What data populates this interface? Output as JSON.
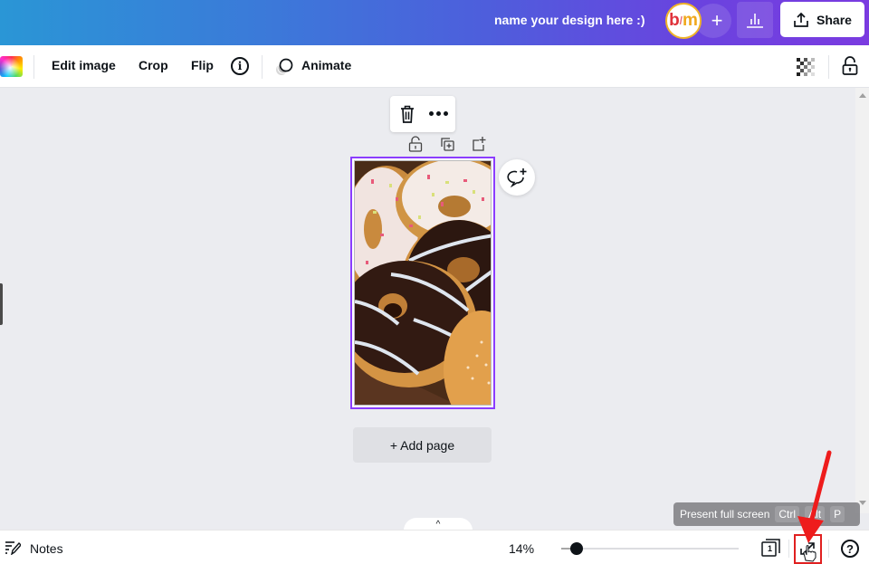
{
  "header": {
    "design_name": "name your design here :)",
    "avatar": {
      "letter1": "b",
      "separator": "/",
      "letter2": "m"
    },
    "add_collaborator_label": "+",
    "insights_icon": "bar-chart-icon",
    "share_label": "Share",
    "share_icon": "upload-icon"
  },
  "toolbar": {
    "color_icon": "color-palette-icon",
    "edit_image_label": "Edit image",
    "crop_label": "Crop",
    "flip_label": "Flip",
    "info_icon": "info-icon",
    "info_glyph": "i",
    "animate_label": "Animate",
    "transparency_icon": "transparency-icon",
    "lock_icon": "lock-icon"
  },
  "canvas": {
    "context_menu": {
      "delete_icon": "trash-icon",
      "more_icon": "more-icon"
    },
    "page_actions": [
      "lock-icon",
      "duplicate-icon",
      "add-page-icon"
    ],
    "comment_icon": "add-comment-icon",
    "page_image": "donuts-photo",
    "add_page_label": "+ Add page"
  },
  "tooltip": {
    "text": "Present full screen",
    "keys": [
      "Ctrl",
      "Alt",
      "P"
    ]
  },
  "bottombar": {
    "expand_glyph": "^",
    "notes_label": "Notes",
    "zoom_value": "14%",
    "zoom_percent": 14,
    "page_count": "1",
    "help_glyph": "?"
  },
  "colors": {
    "accent_purple": "#8b3dff",
    "annotation_red": "#e02020",
    "header_gradient_start": "#2a96d6",
    "header_gradient_end": "#7a3be0"
  }
}
